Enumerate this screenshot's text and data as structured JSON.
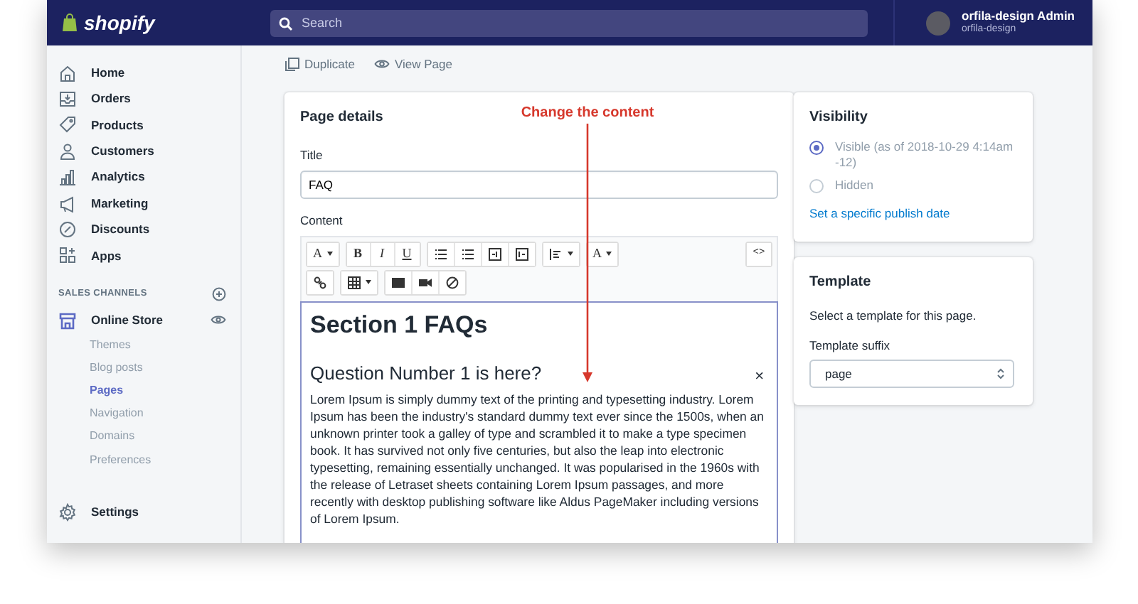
{
  "topbar": {
    "logo": "shopify",
    "search": {
      "placeholder": "Search"
    },
    "user": {
      "name": "orfila-design Admin",
      "store": "orfila-design"
    }
  },
  "sidebar": {
    "items": [
      {
        "label": "Home",
        "selected": false
      },
      {
        "label": "Orders",
        "selected": false
      },
      {
        "label": "Products",
        "selected": false
      },
      {
        "label": "Customers",
        "selected": false
      },
      {
        "label": "Analytics",
        "selected": false
      },
      {
        "label": "Marketing",
        "selected": false
      },
      {
        "label": "Discounts",
        "selected": false
      },
      {
        "label": "Apps",
        "selected": false
      }
    ],
    "section_heading": "SALES CHANNELS",
    "channel": {
      "label": "Online Store",
      "children": [
        {
          "label": "Themes",
          "selected": false
        },
        {
          "label": "Blog posts",
          "selected": false
        },
        {
          "label": "Pages",
          "selected": true
        },
        {
          "label": "Navigation",
          "selected": false
        },
        {
          "label": "Domains",
          "selected": false
        },
        {
          "label": "Preferences",
          "selected": false
        }
      ]
    },
    "settings": "Settings"
  },
  "actions": [
    "Duplicate",
    "View Page"
  ],
  "page_details": {
    "heading": "Page details",
    "title_label": "Title",
    "title_value": "FAQ",
    "content_label": "Content",
    "toolbar_rows": [
      [
        [
          {
            "kind": "text",
            "label": "A",
            "caret": true
          }
        ],
        [
          {
            "kind": "text",
            "label": "B"
          },
          {
            "kind": "text",
            "label": "I"
          },
          {
            "kind": "text",
            "label": "U"
          }
        ],
        [
          {
            "kind": "icon",
            "caret": false
          },
          {
            "kind": "icon",
            "caret": false
          },
          {
            "kind": "icon",
            "caret": false
          },
          {
            "kind": "icon",
            "caret": false
          }
        ],
        [
          {
            "kind": "icon",
            "caret": true
          }
        ],
        [
          {
            "kind": "text",
            "label": "A",
            "caret": true
          }
        ]
      ],
      [
        [
          {
            "kind": "icon",
            "caret": false
          }
        ],
        [
          {
            "kind": "icon",
            "caret": true
          }
        ],
        [
          {
            "kind": "icon",
            "caret": false
          },
          {
            "kind": "icon",
            "caret": false
          },
          {
            "kind": "icon",
            "caret": false
          }
        ]
      ]
    ],
    "code_button": "<>",
    "editor": {
      "heading": "Section 1 FAQs",
      "question": "Question Number 1 is here?",
      "close": "×",
      "paragraphs": [
        "Lorem Ipsum is simply dummy text of the printing and typesetting industry. Lorem Ipsum has been the industry's standard dummy text ever since the 1500s, when an unknown printer took a galley of type and scrambled it to make a type specimen book. It has survived not only five centuries, but also the leap into electronic typesetting, remaining essentially unchanged. It was popularised in the 1960s with the release of Letraset sheets containing Lorem Ipsum passages, and more recently with desktop publishing software like Aldus PageMaker including versions of Lorem Ipsum."
      ]
    }
  },
  "annotation": "Change the content",
  "visibility": {
    "heading": "Visibility",
    "options": [
      {
        "label": "Visible (as of 2018-10-29 4:14am -12)",
        "selected": true
      },
      {
        "label": "Hidden",
        "selected": false
      }
    ],
    "link": "Set a specific publish date"
  },
  "template": {
    "heading": "Template",
    "description": "Select a template for this page.",
    "suffix_label": "Template suffix",
    "suffix_value": "page"
  }
}
